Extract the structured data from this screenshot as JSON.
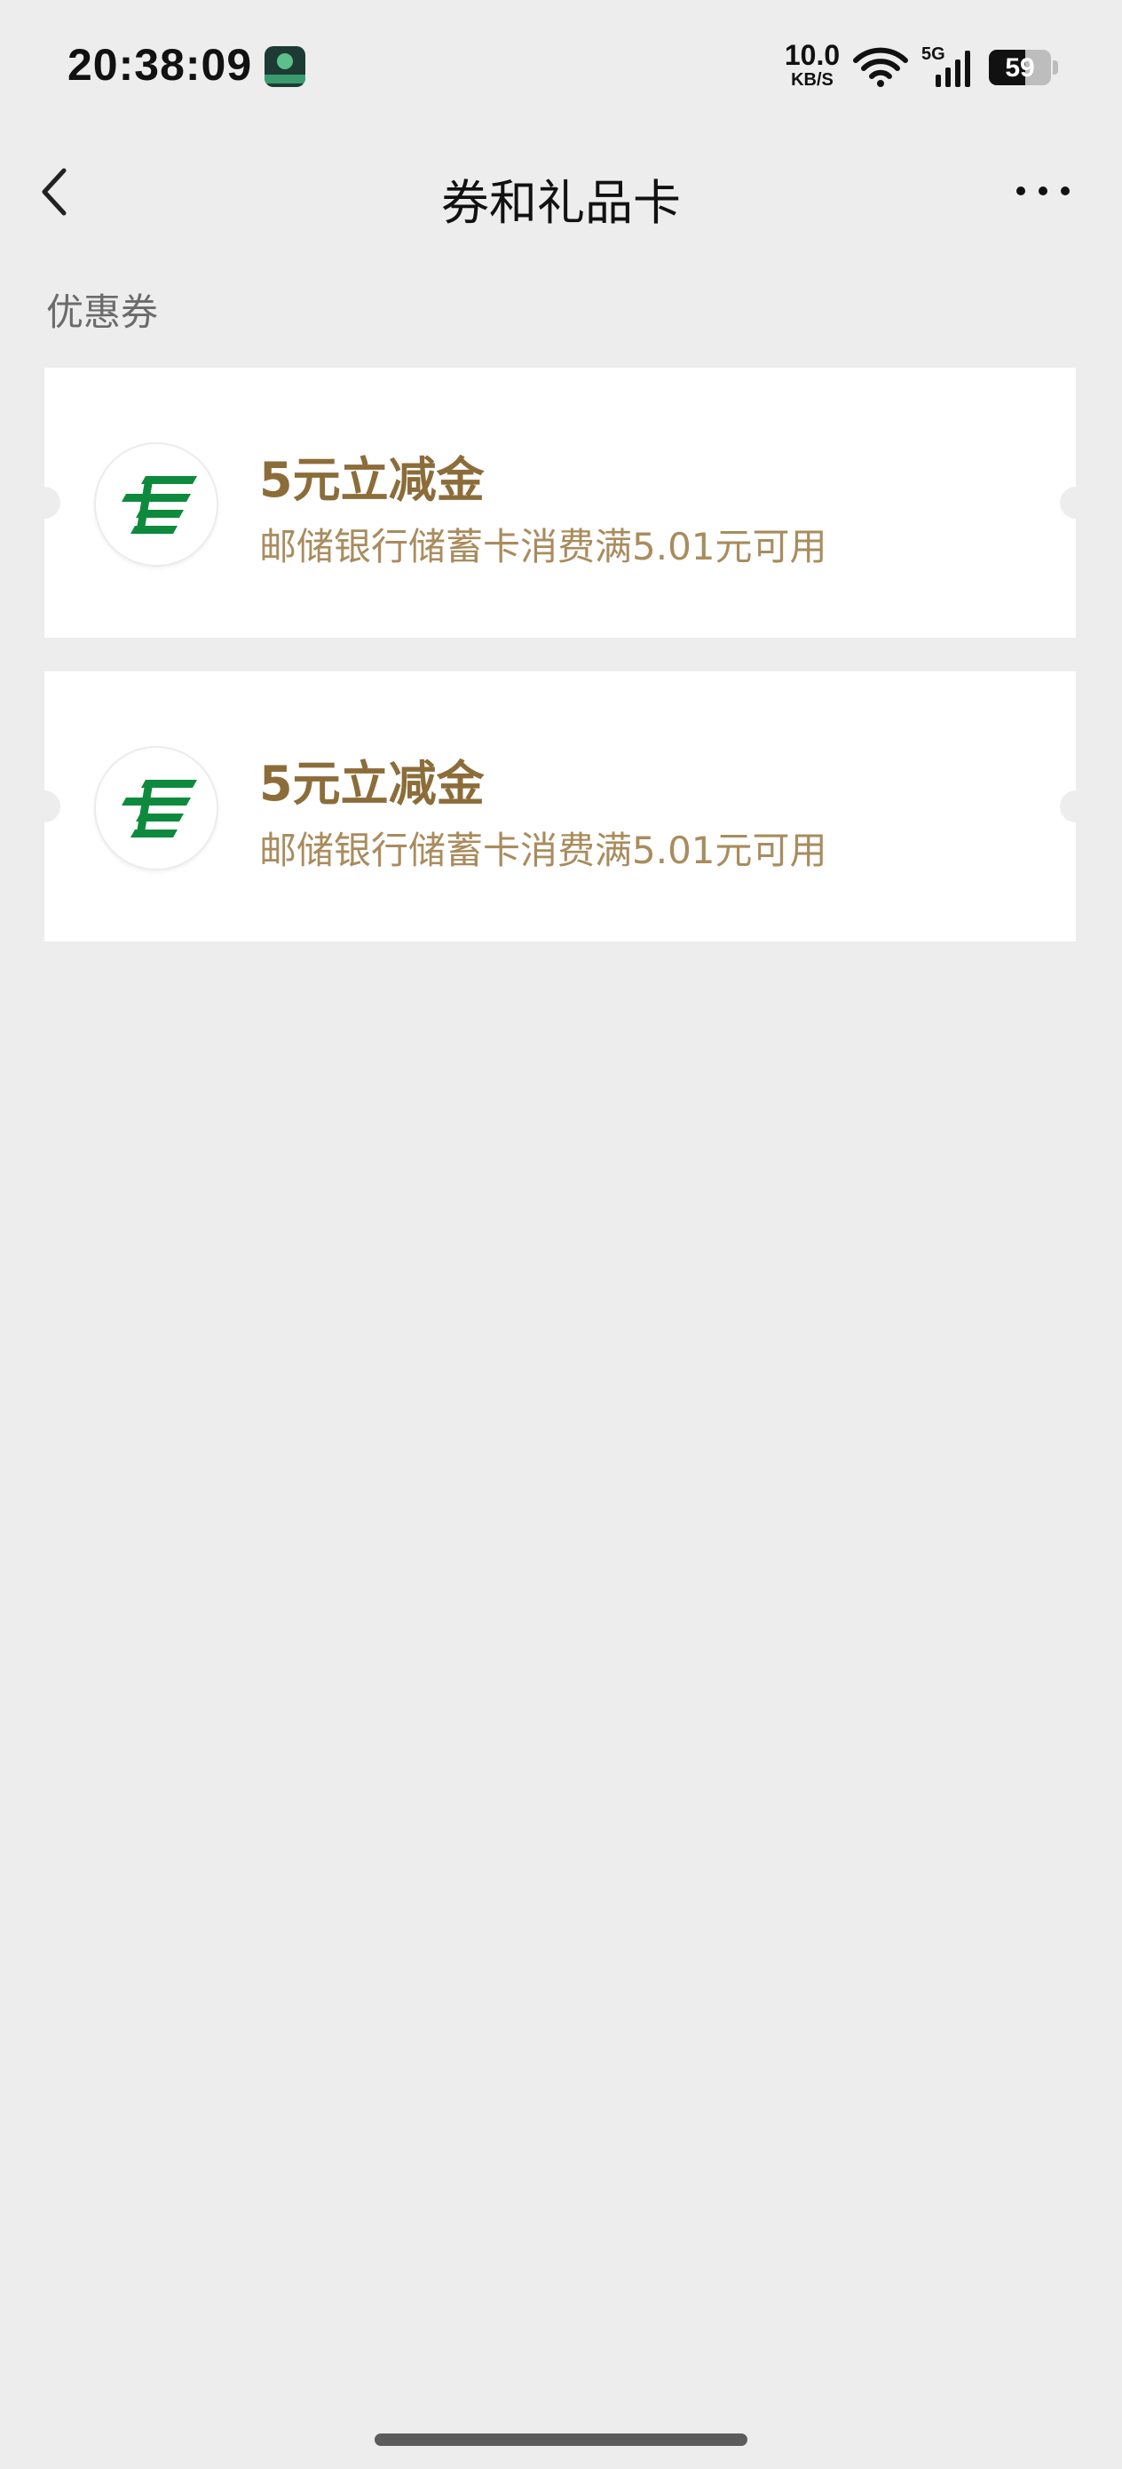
{
  "status_bar": {
    "time": "20:38:09",
    "net_speed_value": "10.0",
    "net_speed_unit": "KB/S",
    "network_type": "5G",
    "battery_level": "59",
    "battery_fraction": 0.59,
    "icons": [
      "app-badge-icon",
      "wifi-icon",
      "signal-icon",
      "battery-icon"
    ]
  },
  "nav": {
    "title": "券和礼品卡",
    "back_icon": "chevron-left-icon",
    "more_icon": "more-dots-icon"
  },
  "section": {
    "label": "优惠券"
  },
  "coupons": [
    {
      "logo_icon": "china-post-logo-icon",
      "title": "5元立减金",
      "description": "邮储银行储蓄卡消费满5.01元可用"
    },
    {
      "logo_icon": "china-post-logo-icon",
      "title": "5元立减金",
      "description": "邮储银行储蓄卡消费满5.01元可用"
    }
  ],
  "colors": {
    "background": "#ededed",
    "card": "#ffffff",
    "coupon_title": "#8c6d3a",
    "coupon_desc": "#a98c5e",
    "logo_green": "#0e8a3e"
  }
}
